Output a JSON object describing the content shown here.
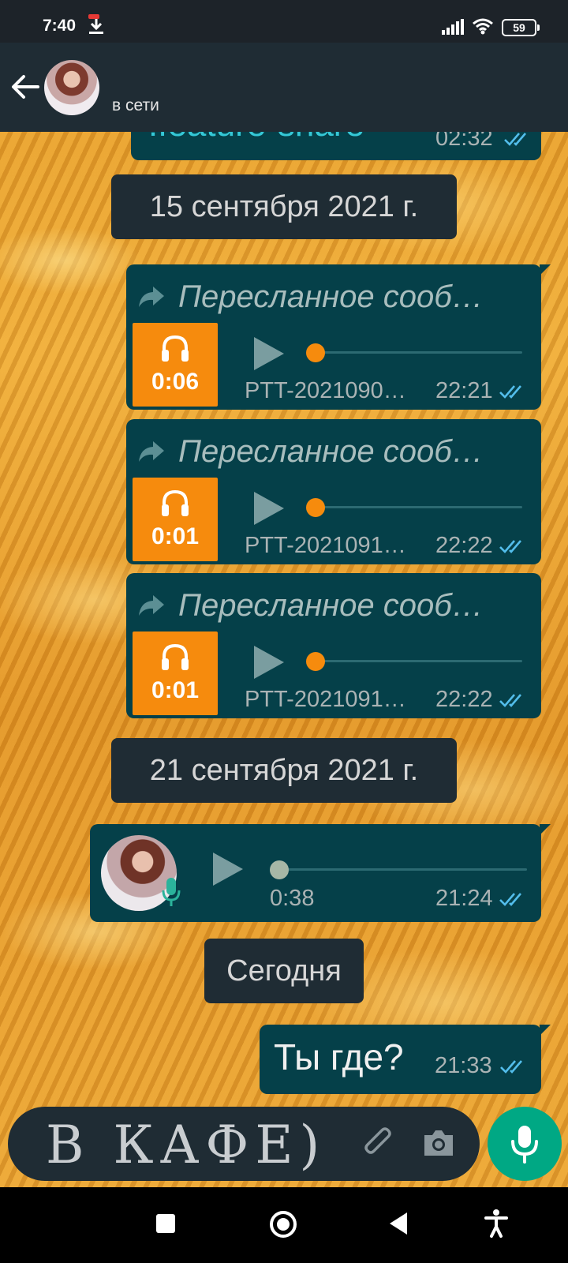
{
  "status_bar": {
    "time": "7:40",
    "battery": "59"
  },
  "header": {
    "status": "в сети"
  },
  "chat": {
    "top_partial_text": "!feature-share",
    "top_partial_time": "02:32",
    "date_1": "15 сентября 2021 г.",
    "forwarded": [
      {
        "label": "Пересланное сооб…",
        "duration": "0:06",
        "file": "PTT-2021090…",
        "time": "22:21"
      },
      {
        "label": "Пересланное сооб…",
        "duration": "0:01",
        "file": "PTT-2021091…",
        "time": "22:22"
      },
      {
        "label": "Пересланное сооб…",
        "duration": "0:01",
        "file": "PTT-2021091…",
        "time": "22:22"
      }
    ],
    "date_2": "21 сентября 2021 г.",
    "voice": {
      "duration": "0:38",
      "time": "21:24"
    },
    "date_3": "Сегодня",
    "last_message": {
      "text": "Ты где?",
      "time": "21:33"
    }
  },
  "input": {
    "text": "В КАФЕ)"
  },
  "colors": {
    "bubble": "#054049",
    "header": "#1f2c34",
    "accent_orange": "#f68b0d",
    "mic_button": "#00a884",
    "read_ticks": "#53bdeb"
  },
  "icons": [
    "back-arrow-icon",
    "download-icon",
    "signal-icon",
    "wifi-icon",
    "battery-icon",
    "forward-icon",
    "headphone-icon",
    "play-icon",
    "mic-icon",
    "paperclip-icon",
    "camera-icon",
    "double-check-icon"
  ]
}
